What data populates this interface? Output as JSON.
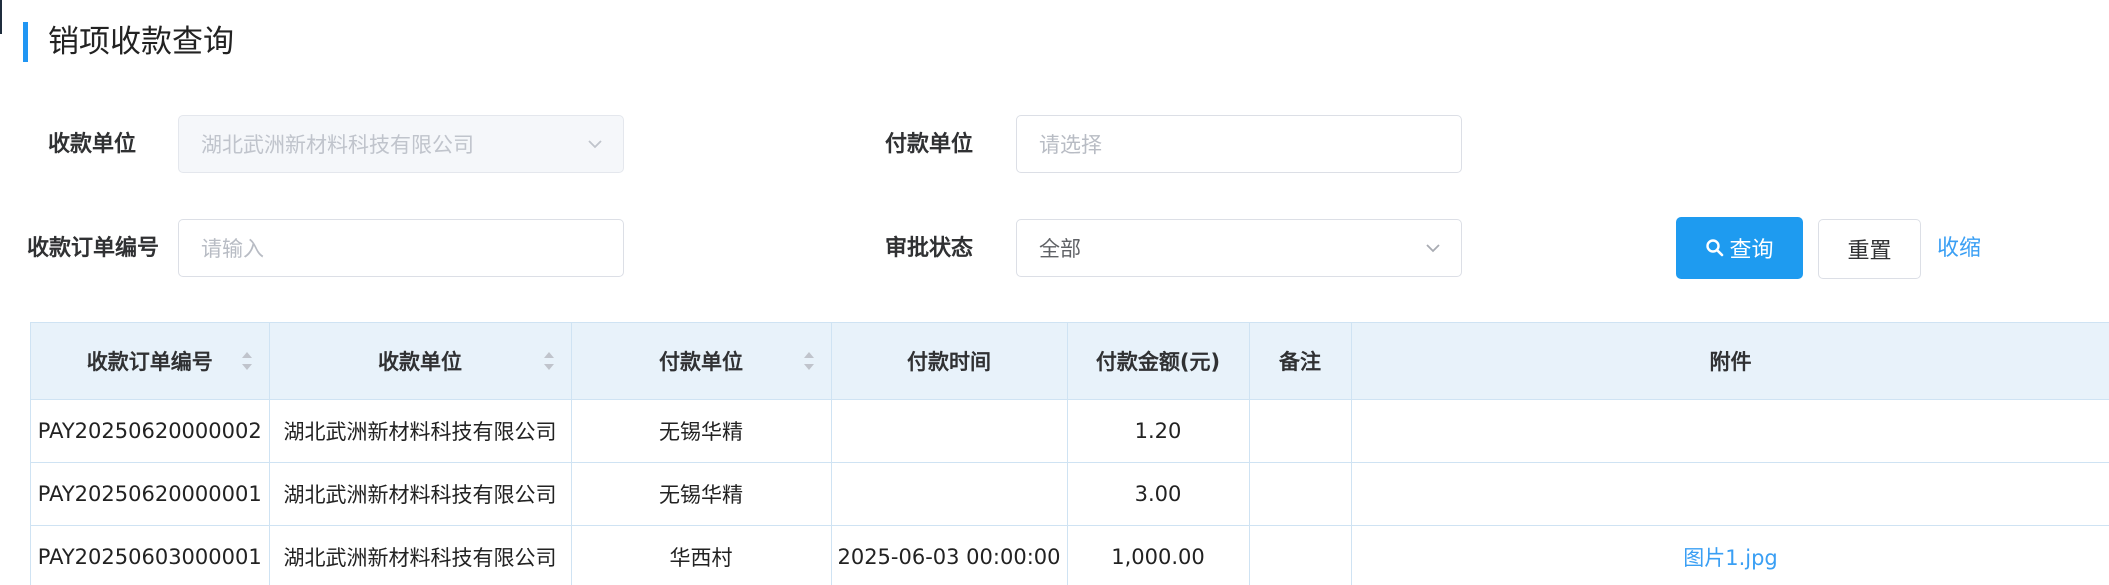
{
  "page": {
    "title": "销项收款查询"
  },
  "colors": {
    "accent": "#2196f3",
    "link": "#3a9ff4",
    "header_bg": "#e8f2fa"
  },
  "form": {
    "payee": {
      "label": "收款单位",
      "value": "湖北武洲新材料科技有限公司",
      "disabled": true,
      "icon": "chevron-down-icon"
    },
    "payer": {
      "label": "付款单位",
      "placeholder": "请选择"
    },
    "order_no": {
      "label": "收款订单编号",
      "placeholder": "请输入"
    },
    "approval": {
      "label": "审批状态",
      "value": "全部",
      "icon": "chevron-down-icon"
    }
  },
  "actions": {
    "search": {
      "label": "查询",
      "icon": "search-icon"
    },
    "reset": {
      "label": "重置"
    },
    "collapse": {
      "label": "收缩"
    }
  },
  "table": {
    "columns": [
      {
        "label": "收款订单编号",
        "sortable": true
      },
      {
        "label": "收款单位",
        "sortable": true
      },
      {
        "label": "付款单位",
        "sortable": true
      },
      {
        "label": "付款时间",
        "sortable": false
      },
      {
        "label": "付款金额(元)",
        "sortable": false
      },
      {
        "label": "备注",
        "sortable": false
      },
      {
        "label": "附件",
        "sortable": false
      }
    ],
    "rows": [
      {
        "order_no": "PAY20250620000002",
        "payee": "湖北武洲新材料科技有限公司",
        "payer": "无锡华精",
        "pay_time": "",
        "amount": "1.20",
        "remark": "",
        "attachment": ""
      },
      {
        "order_no": "PAY20250620000001",
        "payee": "湖北武洲新材料科技有限公司",
        "payer": "无锡华精",
        "pay_time": "",
        "amount": "3.00",
        "remark": "",
        "attachment": ""
      },
      {
        "order_no": "PAY20250603000001",
        "payee": "湖北武洲新材料科技有限公司",
        "payer": "华西村",
        "pay_time": "2025-06-03 00:00:00",
        "amount": "1,000.00",
        "remark": "",
        "attachment": "图片1.jpg"
      }
    ]
  }
}
